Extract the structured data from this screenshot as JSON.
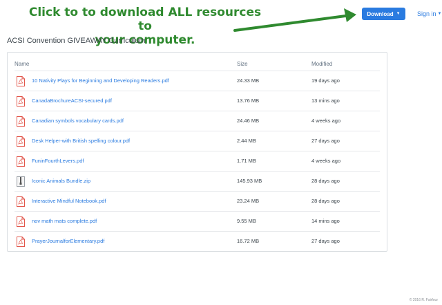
{
  "annotation": {
    "line1": "Click to to download ALL resources to",
    "line2": "your computer."
  },
  "header": {
    "download_label": "Download",
    "signin_label": "Sign in"
  },
  "folder_title": "ACSI Convention GIVEAWAY Curriculum",
  "columns": {
    "name": "Name",
    "size": "Size",
    "modified": "Modified"
  },
  "files": [
    {
      "name": "10 Nativity Plays for Beginning and Developing Readers.pdf",
      "size": "24.33 MB",
      "modified": "19 days ago",
      "icon": "pdf-file-icon"
    },
    {
      "name": "CanadaBrochureACSI-secured.pdf",
      "size": "13.76 MB",
      "modified": "13 mins ago",
      "icon": "pdf-file-icon"
    },
    {
      "name": "Canadian symbols vocabulary cards.pdf",
      "size": "24.46 MB",
      "modified": "4 weeks ago",
      "icon": "pdf-file-icon"
    },
    {
      "name": "Desk Helper-with British spelling colour.pdf",
      "size": "2.44 MB",
      "modified": "27 days ago",
      "icon": "pdf-file-icon"
    },
    {
      "name": "FuninFourthLevers.pdf",
      "size": "1.71 MB",
      "modified": "4 weeks ago",
      "icon": "pdf-file-icon"
    },
    {
      "name": "Iconic Animals Bundle.zip",
      "size": "145.93 MB",
      "modified": "28 days ago",
      "icon": "zip-file-icon"
    },
    {
      "name": "Interactive Mindful Notebook.pdf",
      "size": "23.24 MB",
      "modified": "28 days ago",
      "icon": "pdf-file-icon"
    },
    {
      "name": "nov math mats complete.pdf",
      "size": "9.55 MB",
      "modified": "14 mins ago",
      "icon": "pdf-file-icon"
    },
    {
      "name": "PrayerJournalforElementary.pdf",
      "size": "16.72 MB",
      "modified": "27 days ago",
      "icon": "pdf-file-icon"
    }
  ],
  "copyright": "© 2016 R. Fairfour",
  "colors": {
    "accent": "#2a7be0",
    "annotation": "#2f8a2f",
    "pdf": "#e2574c"
  }
}
